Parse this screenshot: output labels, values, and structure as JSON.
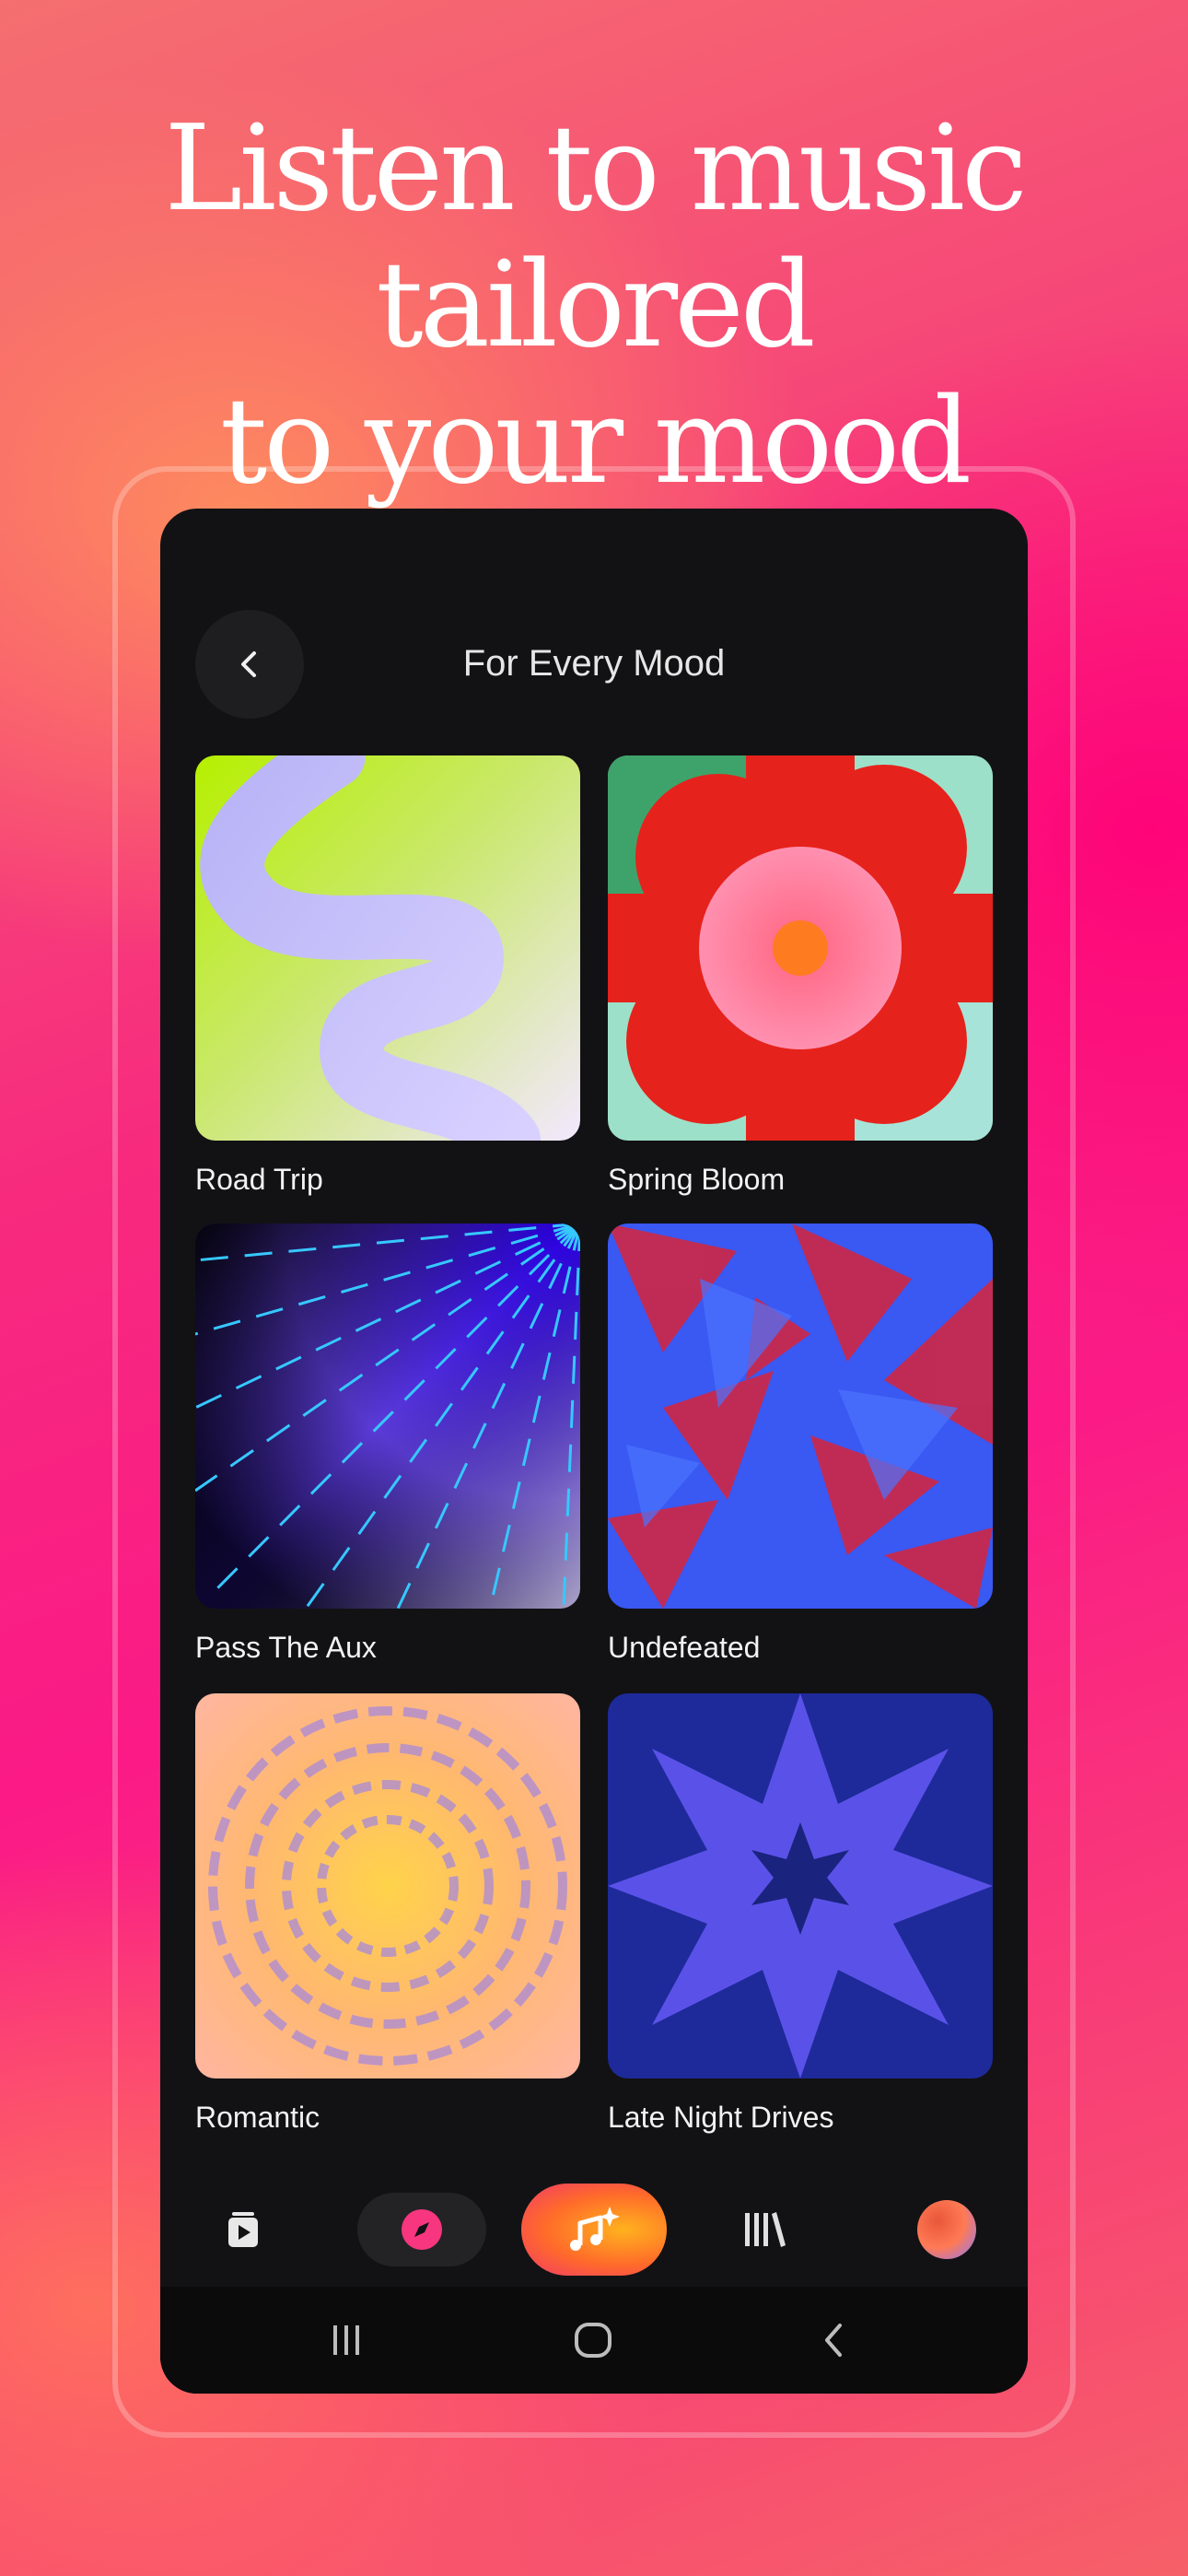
{
  "headline": {
    "line1": "Listen to music tailored",
    "line2": "to your mood"
  },
  "screen": {
    "title": "For Every Mood",
    "back_icon": "chevron-left-icon"
  },
  "moods": [
    {
      "label": "Road Trip"
    },
    {
      "label": "Spring Bloom"
    },
    {
      "label": "Pass The Aux"
    },
    {
      "label": "Undefeated"
    },
    {
      "label": "Romantic"
    },
    {
      "label": "Late Night Drives"
    }
  ],
  "bottom_nav": {
    "items": [
      "play-queue-icon",
      "compass-icon",
      "music-sparkle-icon",
      "library-icon",
      "profile-avatar"
    ],
    "active": "compass-icon",
    "accent": "#f7367f"
  },
  "system_nav": [
    "recent-apps-icon",
    "home-icon",
    "back-icon"
  ]
}
